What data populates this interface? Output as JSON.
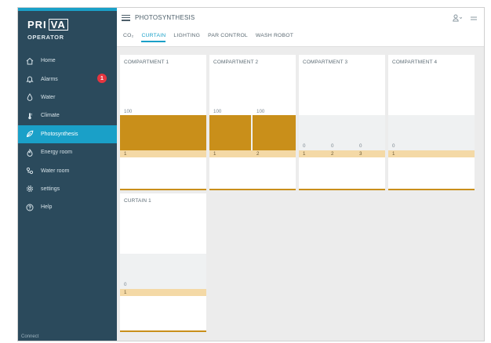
{
  "app": {
    "brand_left": "PRI",
    "brand_right": "VA",
    "operator": "OPERATOR",
    "connect": "Connect"
  },
  "sidebar": {
    "items": [
      {
        "label": "Home",
        "icon": "home-icon"
      },
      {
        "label": "Alarms",
        "icon": "bell-icon",
        "badge": "1"
      },
      {
        "label": "Water",
        "icon": "water-drop-icon"
      },
      {
        "label": "Climate",
        "icon": "thermometer-icon"
      },
      {
        "label": "Photosynthesis",
        "icon": "leaf-icon",
        "active": true
      },
      {
        "label": "Energy room",
        "icon": "flame-icon"
      },
      {
        "label": "Water room",
        "icon": "pipes-icon"
      },
      {
        "label": "settings",
        "icon": "gear-icon"
      },
      {
        "label": "Help",
        "icon": "help-icon"
      }
    ]
  },
  "header": {
    "title": "PHOTOSYNTHESIS",
    "user_icon": "user-icon",
    "more_icon": "more-icon"
  },
  "tabs": [
    {
      "label": "CO₂"
    },
    {
      "label": "CURTAIN",
      "active": true
    },
    {
      "label": "LIGHTING"
    },
    {
      "label": "PAR CONTROL"
    },
    {
      "label": "WASH ROBOT"
    }
  ],
  "cards": [
    {
      "title": "COMPARTMENT 1",
      "columns": [
        {
          "value": "100",
          "num": "1",
          "level": 1.0
        }
      ]
    },
    {
      "title": "COMPARTMENT 2",
      "columns": [
        {
          "value": "100",
          "num": "1",
          "level": 1.0
        },
        {
          "value": "100",
          "num": "2",
          "level": 1.0
        }
      ]
    },
    {
      "title": "COMPARTMENT 3",
      "columns": [
        {
          "value": "0",
          "num": "1",
          "level": 0
        },
        {
          "value": "0",
          "num": "2",
          "level": 0
        },
        {
          "value": "0",
          "num": "3",
          "level": 0
        }
      ]
    },
    {
      "title": "COMPARTMENT 4",
      "columns": [
        {
          "value": "0",
          "num": "1",
          "level": 0
        }
      ]
    },
    {
      "title": "CURTAIN 1",
      "columns": [
        {
          "value": "0",
          "num": "1",
          "level": 0
        }
      ]
    }
  ],
  "colors": {
    "sidebar": "#2b4a5c",
    "accent": "#1aa0c8",
    "curtain_fill": "#c98f1a",
    "strip": "#f4d9a6",
    "alarm": "#e5353f"
  }
}
